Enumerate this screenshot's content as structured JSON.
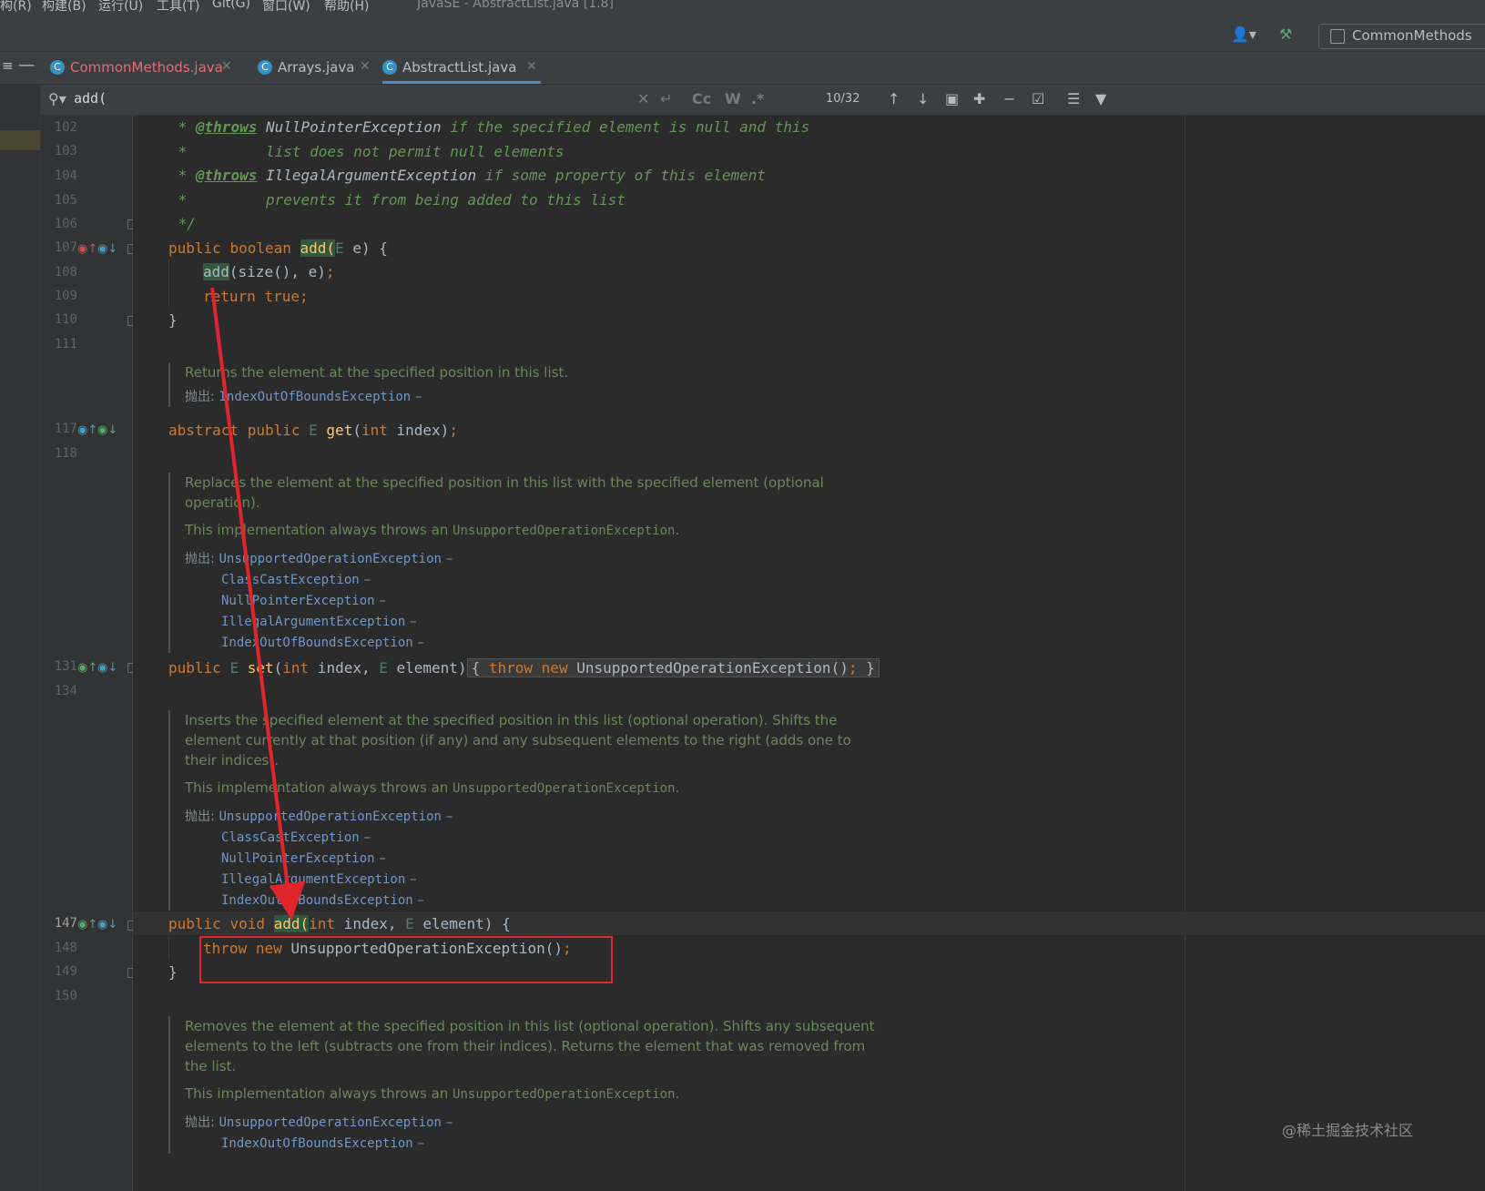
{
  "menubar": {
    "items": [
      "构(R)",
      "构建(B)",
      "运行(U)",
      "工具(T)",
      "Git(G)",
      "窗口(W)",
      "帮助(H)"
    ],
    "window_title": "JavaSE - AbstractList.java [1.8]"
  },
  "toolbar": {
    "run_config_label": "CommonMethods",
    "icons": [
      "user-icon",
      "build-hammer-icon",
      "run-config-icon"
    ]
  },
  "tabs": [
    {
      "label": "CommonMethods.java",
      "color": "#e06c75",
      "active": false
    },
    {
      "label": "Arrays.java",
      "color": "#bbbbbb",
      "active": false
    },
    {
      "label": "AbstractList.java",
      "color": "#bbbbbb",
      "active": true
    }
  ],
  "findbar": {
    "search_value": "add(",
    "match_count": "10/32",
    "case_label": "Cc",
    "word_label": "W",
    "regex_label": ".*"
  },
  "gutter": {
    "line_numbers": [
      "102",
      "103",
      "104",
      "105",
      "106",
      "107",
      "108",
      "109",
      "110",
      "111",
      "117",
      "118",
      "131",
      "134",
      "147",
      "148",
      "149",
      "150"
    ]
  },
  "code": {
    "l102": {
      "star": " * ",
      "tag": "@throws",
      "type": " NullPointerException",
      "text": " if the specified element is null and this"
    },
    "l103": {
      "text": " *         list does not permit null elements"
    },
    "l104": {
      "star": " * ",
      "tag": "@throws",
      "type": " IllegalArgumentException",
      "text": " if some property of this element"
    },
    "l105": {
      "text": " *         prevents it from being added to this list"
    },
    "l106": {
      "text": " */"
    },
    "l107": {
      "kw1": "public",
      "kw2": "boolean",
      "fn": "add(",
      "tp": "E",
      "rest": " e) {"
    },
    "l108": {
      "fn": "add",
      "rest": "(size(), e)",
      "semi": ";"
    },
    "l109": {
      "kw": "return",
      "kw2": "true",
      "semi": ";"
    },
    "l110": {
      "text": "}"
    },
    "l117": {
      "kw1": "abstract",
      "kw2": "public",
      "tp": "E",
      "fn": "get",
      "p1": "(",
      "kw3": "int",
      "rest": " index)",
      "semi": ";"
    },
    "l131": {
      "kw1": "public",
      "tp": "E",
      "fn": "set",
      "p1": "(",
      "kw2": "int",
      "rest1": " index, ",
      "tp2": "E",
      "rest2": " element)",
      "ob": "{",
      "kw3": "throw",
      "kw4": "new",
      "rest3": " UnsupportedOperationException()",
      "semi": ";",
      "cb": "}"
    },
    "l147": {
      "kw1": "public",
      "kw2": "void",
      "fn": "add(",
      "kw3": "int",
      "rest1": " index, ",
      "tp": "E",
      "rest2": " element) {"
    },
    "l148": {
      "kw1": "throw",
      "kw2": "new",
      "rest": " UnsupportedOperationException()",
      "semi": ";"
    },
    "l149": {
      "text": "}"
    }
  },
  "docs": {
    "get": {
      "desc": "Returns the element at the specified position in this list.",
      "throws_label": "抛出:",
      "exceptions": [
        "IndexOutOfBoundsException"
      ],
      "dash": "–"
    },
    "set": {
      "desc_lines": [
        "Replaces the element at the specified position in this list with the specified element (optional",
        "operation)."
      ],
      "impl_prefix": "This implementation always throws an ",
      "impl_code": "UnsupportedOperationException",
      "impl_suffix": ".",
      "throws_label": "抛出:",
      "exceptions": [
        "UnsupportedOperationException",
        "ClassCastException",
        "NullPointerException",
        "IllegalArgumentException",
        "IndexOutOfBoundsException"
      ],
      "dash": "–"
    },
    "add": {
      "desc_lines": [
        "Inserts the specified element at the specified position in this list (optional operation). Shifts the",
        "element currently at that position (if any) and any subsequent elements to the right (adds one to",
        "their indices)."
      ],
      "impl_prefix": "This implementation always throws an ",
      "impl_code": "UnsupportedOperationException",
      "impl_suffix": ".",
      "throws_label": "抛出:",
      "exceptions": [
        "UnsupportedOperationException",
        "ClassCastException",
        "NullPointerException",
        "IllegalArgumentException",
        "IndexOutOfBoundsException"
      ],
      "dash": "–"
    },
    "remove": {
      "desc_lines": [
        "Removes the element at the specified position in this list (optional operation). Shifts any subsequent",
        "elements to the left (subtracts one from their indices). Returns the element that was removed from",
        "the list."
      ],
      "impl_prefix": "This implementation always throws an ",
      "impl_code": "UnsupportedOperationException",
      "impl_suffix": ".",
      "throws_label": "抛出:",
      "exceptions": [
        "UnsupportedOperationException",
        "IndexOutOfBoundsException"
      ],
      "dash": "–"
    }
  },
  "annotations": {
    "arrow_color": "#e0262c",
    "box_color": "#e0262c"
  },
  "watermark": "@稀土掘金技术社区"
}
